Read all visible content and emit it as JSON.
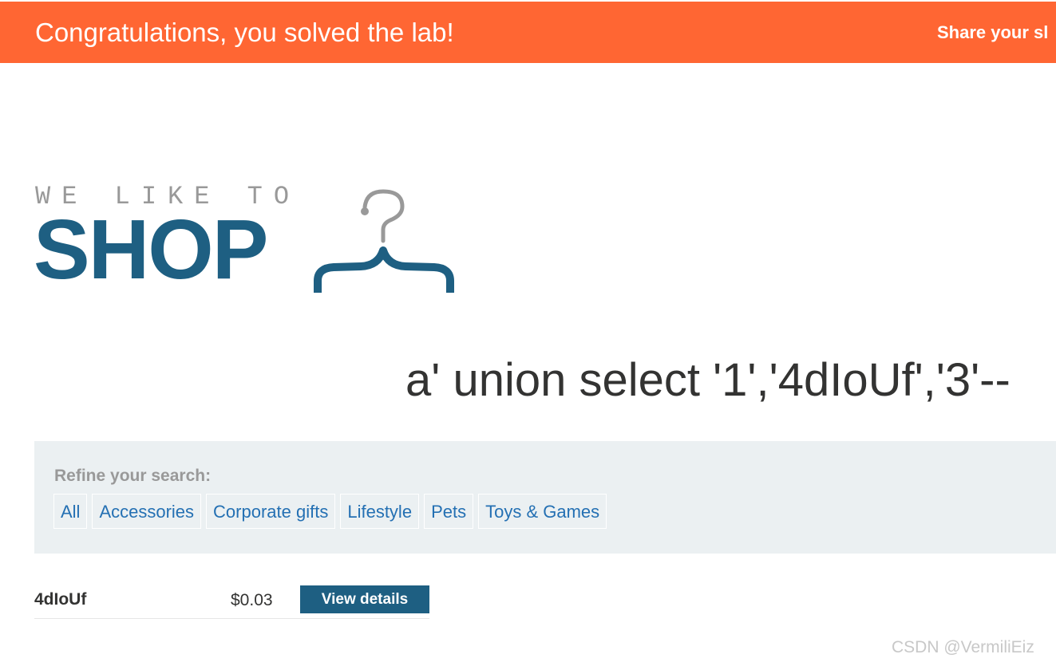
{
  "banner": {
    "message": "Congratulations, you solved the lab!",
    "share_label": "Share your sl",
    "color": "#ff6633"
  },
  "logo": {
    "tagline": "WE LIKE TO",
    "wordmark": "SHOP",
    "icon": "hanger-icon",
    "brand_color": "#1e5f82"
  },
  "search": {
    "term": "a' union select '1','4dIoUf','3'--"
  },
  "filters": {
    "label": "Refine your search:",
    "items": [
      {
        "label": "All"
      },
      {
        "label": "Accessories"
      },
      {
        "label": "Corporate gifts"
      },
      {
        "label": "Lifestyle"
      },
      {
        "label": "Pets"
      },
      {
        "label": "Toys & Games"
      }
    ],
    "link_color": "#2470b3"
  },
  "products": [
    {
      "name": "4dIoUf",
      "price": "$0.03",
      "action_label": "View details"
    }
  ],
  "watermark": "CSDN @VermiliEiz"
}
